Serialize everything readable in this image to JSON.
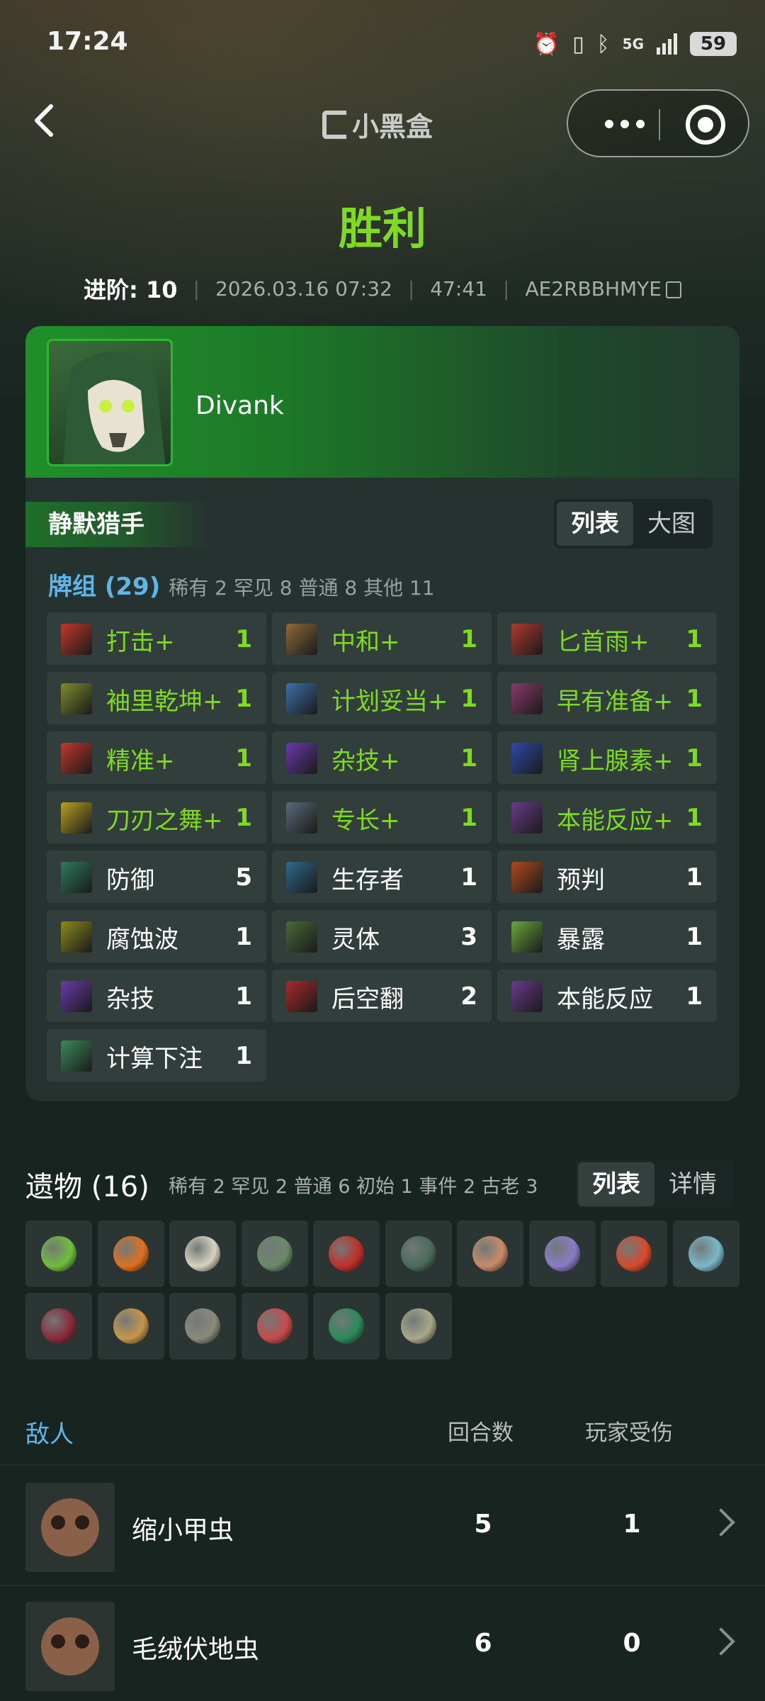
{
  "status_bar": {
    "time": "17:24",
    "network": "5G",
    "battery": "59"
  },
  "nav": {
    "brand": "小黑盒"
  },
  "result": "胜利",
  "meta": {
    "ascension": "进阶: 10",
    "datetime": "2026.03.16 07:32",
    "duration": "47:41",
    "seed": "AE2RBBHMYE"
  },
  "player": {
    "name": "Divank",
    "character": "静默猎手"
  },
  "deck_view": {
    "list": "列表",
    "image": "大图"
  },
  "deck": {
    "title": "牌组 (29)",
    "stats": "稀有 2  罕见 8  普通 8  其他 11",
    "cards": [
      {
        "name": "打击+",
        "count": "1",
        "upgraded": true,
        "color": "#c0392b"
      },
      {
        "name": "中和+",
        "count": "1",
        "upgraded": true,
        "color": "#8e6a3a"
      },
      {
        "name": "匕首雨+",
        "count": "1",
        "upgraded": true,
        "color": "#b03a2e"
      },
      {
        "name": "袖里乾坤+",
        "count": "1",
        "upgraded": true,
        "color": "#7d8c2a"
      },
      {
        "name": "计划妥当+",
        "count": "1",
        "upgraded": true,
        "color": "#3e6fa8"
      },
      {
        "name": "早有准备+",
        "count": "1",
        "upgraded": true,
        "color": "#8a3a6a"
      },
      {
        "name": "精准+",
        "count": "1",
        "upgraded": true,
        "color": "#c0392b"
      },
      {
        "name": "杂技+",
        "count": "1",
        "upgraded": true,
        "color": "#6a3aa8"
      },
      {
        "name": "肾上腺素+",
        "count": "1",
        "upgraded": true,
        "color": "#2e4aa8"
      },
      {
        "name": "刀刃之舞+",
        "count": "1",
        "upgraded": true,
        "color": "#b8a020"
      },
      {
        "name": "专长+",
        "count": "1",
        "upgraded": true,
        "color": "#5a6a7a"
      },
      {
        "name": "本能反应+",
        "count": "1",
        "upgraded": true,
        "color": "#6a3a8a"
      },
      {
        "name": "防御",
        "count": "5",
        "upgraded": false,
        "color": "#2e7a5a"
      },
      {
        "name": "生存者",
        "count": "1",
        "upgraded": false,
        "color": "#2e6a8a"
      },
      {
        "name": "预判",
        "count": "1",
        "upgraded": false,
        "color": "#b04a1a"
      },
      {
        "name": "腐蚀波",
        "count": "1",
        "upgraded": false,
        "color": "#8a8a1a"
      },
      {
        "name": "灵体",
        "count": "3",
        "upgraded": false,
        "color": "#4a6a3a"
      },
      {
        "name": "暴露",
        "count": "1",
        "upgraded": false,
        "color": "#6aa83a"
      },
      {
        "name": "杂技",
        "count": "1",
        "upgraded": false,
        "color": "#6a3aa8"
      },
      {
        "name": "后空翻",
        "count": "2",
        "upgraded": false,
        "color": "#a82a2a"
      },
      {
        "name": "本能反应",
        "count": "1",
        "upgraded": false,
        "color": "#6a3a8a"
      },
      {
        "name": "计算下注",
        "count": "1",
        "upgraded": false,
        "color": "#3a8a5a"
      }
    ]
  },
  "relics": {
    "title": "遗物 (16)",
    "stats": "稀有 2  罕见 2  普通 6  初始 1  事件 2  古老 3",
    "view_list": "列表",
    "view_detail": "详情",
    "items": [
      {
        "icon": "green-ring-icon",
        "color": "#6fbf3a"
      },
      {
        "icon": "orange-shell-icon",
        "color": "#e0701e"
      },
      {
        "icon": "skull-icon",
        "color": "#d8d2c0"
      },
      {
        "icon": "crown-icon",
        "color": "#6a8a6a"
      },
      {
        "icon": "red-gem-icon",
        "color": "#c0302a"
      },
      {
        "icon": "lantern-icon",
        "color": "#4a6a5a"
      },
      {
        "icon": "teacup-icon",
        "color": "#c88a6a"
      },
      {
        "icon": "doll-icon",
        "color": "#8a7ac8"
      },
      {
        "icon": "flower-icon",
        "color": "#d84a2a"
      },
      {
        "icon": "ticket-icon",
        "color": "#7ab8c8"
      },
      {
        "icon": "cloak-icon",
        "color": "#8a2a3a"
      },
      {
        "icon": "crystal-icon",
        "color": "#c8964a"
      },
      {
        "icon": "pentagon-icon",
        "color": "#8a8a7a"
      },
      {
        "icon": "chest-icon",
        "color": "#c84a4a"
      },
      {
        "icon": "snake-icon",
        "color": "#2a8a5a"
      },
      {
        "icon": "cradle-icon",
        "color": "#a8a88a"
      }
    ]
  },
  "enemies": {
    "header": {
      "enemy": "敌人",
      "turns": "回合数",
      "damage": "玩家受伤"
    },
    "rows": [
      {
        "name": "缩小甲虫",
        "turns": "5",
        "damage": "1"
      },
      {
        "name": "毛绒伏地虫",
        "turns": "6",
        "damage": "0"
      }
    ]
  },
  "colors": {
    "victory": "#7ddc1f",
    "accent_blue": "#5fb4e8",
    "card_bg": "#263230"
  }
}
